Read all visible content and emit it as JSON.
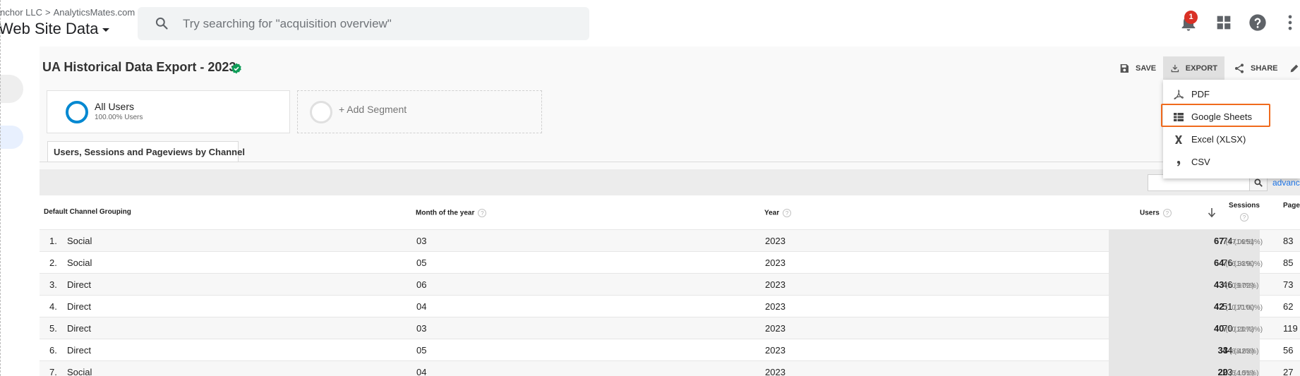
{
  "header": {
    "breadcrumb_account": "nchor LLC",
    "breadcrumb_sep": ">",
    "breadcrumb_property": "AnalyticsMates.com",
    "property_view": "Web Site Data",
    "search_placeholder": "Try searching for \"acquisition overview\"",
    "notification_count": "1",
    "icons": [
      "search-icon",
      "bell-icon",
      "apps-grid-icon",
      "help-icon",
      "more-vert-icon"
    ]
  },
  "report": {
    "title": "UA Historical Data Export - 2023",
    "verified_icon": "verified-shield-icon"
  },
  "toolbar": {
    "save_label": "SAVE",
    "export_label": "EXPORT",
    "share_label": "SHARE"
  },
  "segments": {
    "active_name": "All Users",
    "active_sub": "100.00% Users",
    "add_label": "+ Add Segment"
  },
  "tab": {
    "label": "Users, Sessions and Pageviews by Channel"
  },
  "filter": {
    "advanced_label": "advanc"
  },
  "table": {
    "columns": {
      "channel": "Default Channel Grouping",
      "month": "Month of the year",
      "year": "Year",
      "users": "Users",
      "sessions": "Sessions",
      "pageviews": "Page"
    },
    "help_mark": "?",
    "rows": [
      {
        "num": "1.",
        "channel": "Social",
        "month": "03",
        "year": "2023",
        "users": "67",
        "users_pct": "(17.09%)",
        "sessions": "74",
        "sessions_pct": "(14.51%)",
        "pageviews": "83"
      },
      {
        "num": "2.",
        "channel": "Social",
        "month": "05",
        "year": "2023",
        "users": "64",
        "users_pct": "(16.33%)",
        "sessions": "76",
        "sessions_pct": "(14.90%)",
        "pageviews": "85"
      },
      {
        "num": "3.",
        "channel": "Direct",
        "month": "06",
        "year": "2023",
        "users": "43",
        "users_pct": "(10.97%)",
        "sessions": "46",
        "sessions_pct": "(9.02%)",
        "pageviews": "73"
      },
      {
        "num": "4.",
        "channel": "Direct",
        "month": "04",
        "year": "2023",
        "users": "42",
        "users_pct": "(10.71%)",
        "sessions": "51",
        "sessions_pct": "(10.00%)",
        "pageviews": "62"
      },
      {
        "num": "5.",
        "channel": "Direct",
        "month": "03",
        "year": "2023",
        "users": "40",
        "users_pct": "(10.20%)",
        "sessions": "70",
        "sessions_pct": "(13.73%)",
        "pageviews": "119"
      },
      {
        "num": "6.",
        "channel": "Direct",
        "month": "05",
        "year": "2023",
        "users": "33",
        "users_pct": "(8.42%)",
        "sessions": "44",
        "sessions_pct": "(8.63%)",
        "pageviews": "56"
      },
      {
        "num": "7.",
        "channel": "Social",
        "month": "04",
        "year": "2023",
        "users": "20",
        "users_pct": "(5.10%)",
        "sessions": "23",
        "sessions_pct": "(4.51%)",
        "pageviews": "27"
      }
    ]
  },
  "export_menu": {
    "items": [
      {
        "label": "PDF",
        "icon": "pdf-icon"
      },
      {
        "label": "Google Sheets",
        "icon": "google-sheets-icon"
      },
      {
        "label": "Excel (XLSX)",
        "icon": "excel-icon"
      },
      {
        "label": "CSV",
        "icon": "csv-icon"
      }
    ],
    "highlighted_item": "Google Sheets"
  },
  "colors": {
    "accent_blue": "#0288d1",
    "verified_green": "#0f9d58",
    "badge_red": "#d93025",
    "highlight_orange": "#f06a1d"
  }
}
